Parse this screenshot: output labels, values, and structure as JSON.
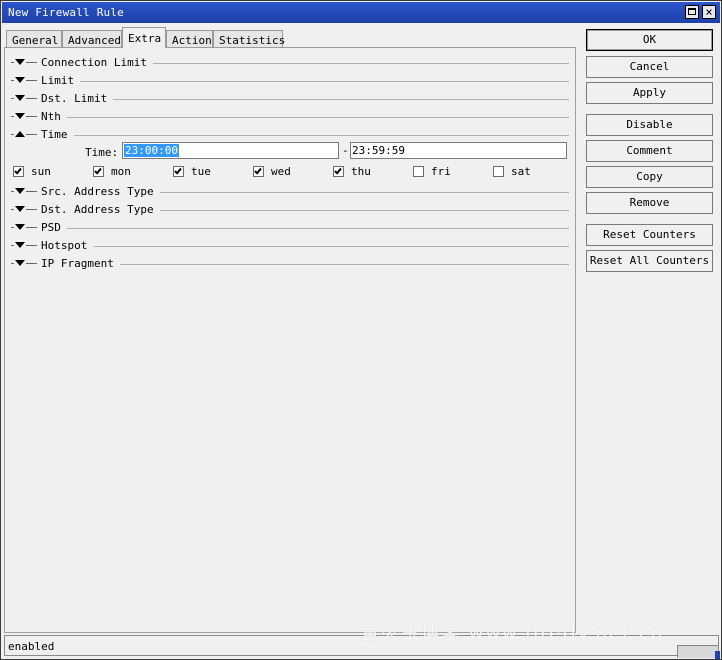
{
  "window": {
    "title": "New Firewall Rule"
  },
  "tabs": [
    {
      "label": "General"
    },
    {
      "label": "Advanced"
    },
    {
      "label": "Extra"
    },
    {
      "label": "Action"
    },
    {
      "label": "Statistics"
    }
  ],
  "sections_before": [
    {
      "label": "Connection Limit"
    },
    {
      "label": "Limit"
    },
    {
      "label": "Dst. Limit"
    },
    {
      "label": "Nth"
    },
    {
      "label": "Time"
    }
  ],
  "time": {
    "label": "Time:",
    "from_value": "23:00:00",
    "separator": "-",
    "to_value": "23:59:59"
  },
  "days": [
    {
      "label": "sun",
      "checked": true
    },
    {
      "label": "mon",
      "checked": true
    },
    {
      "label": "tue",
      "checked": true
    },
    {
      "label": "wed",
      "checked": true
    },
    {
      "label": "thu",
      "checked": true
    },
    {
      "label": "fri",
      "checked": false
    },
    {
      "label": "sat",
      "checked": false
    }
  ],
  "sections_after": [
    {
      "label": "Src. Address Type"
    },
    {
      "label": "Dst. Address Type"
    },
    {
      "label": "PSD"
    },
    {
      "label": "Hotspot"
    },
    {
      "label": "IP Fragment"
    }
  ],
  "buttons": {
    "ok": "OK",
    "cancel": "Cancel",
    "apply": "Apply",
    "disable": "Disable",
    "comment": "Comment",
    "copy": "Copy",
    "remove": "Remove",
    "reset_counters": "Reset Counters",
    "reset_all_counters": "Reset All Counters"
  },
  "status": {
    "text": "enabled"
  },
  "watermark": "萤火虫博客 www.firefly.net.cn"
}
